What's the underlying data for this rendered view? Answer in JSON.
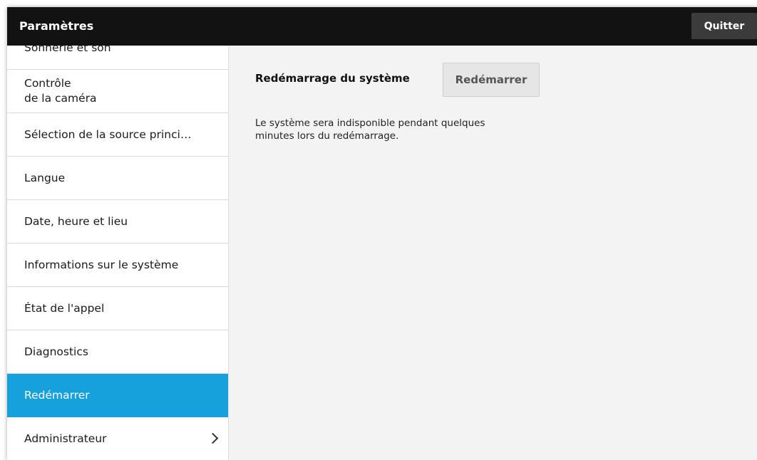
{
  "header": {
    "title": "Paramètres",
    "quit_label": "Quitter"
  },
  "sidebar": {
    "items": [
      {
        "label": "Sonnerie et son"
      },
      {
        "label": "Contrôle\nde la caméra"
      },
      {
        "label": "Sélection de la source princi…"
      },
      {
        "label": "Langue"
      },
      {
        "label": "Date, heure et lieu"
      },
      {
        "label": "Informations sur le système"
      },
      {
        "label": "État de l'appel"
      },
      {
        "label": "Diagnostics"
      },
      {
        "label": "Redémarrer",
        "active": true
      },
      {
        "label": "Administrateur",
        "has_submenu": true
      }
    ]
  },
  "main": {
    "section_title": "Redémarrage du système",
    "restart_button_label": "Redémarrer",
    "description": "Le système sera indisponible pendant quelques minutes lors du redémarrage."
  },
  "colors": {
    "active_item": "#16a0dc",
    "topbar": "#121212",
    "background": "#f3f3f3"
  },
  "icons": {
    "submenu": "chevron-right-icon"
  }
}
